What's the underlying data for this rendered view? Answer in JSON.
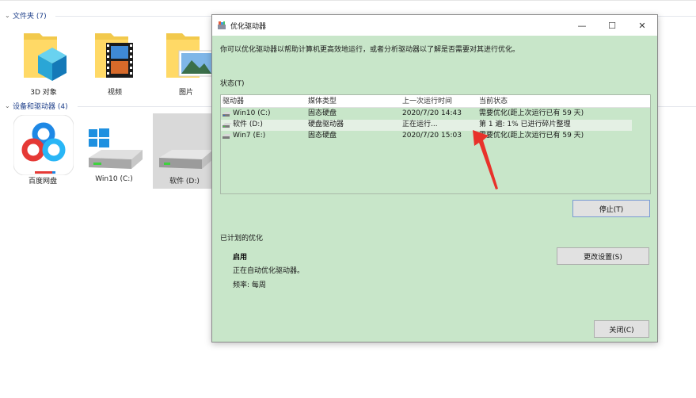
{
  "explorer": {
    "folders_group": {
      "label": "文件夹 (7)"
    },
    "folders": [
      {
        "label": "3D 对象",
        "icon": "3d-objects-folder-icon"
      },
      {
        "label": "视频",
        "icon": "videos-folder-icon"
      },
      {
        "label": "图片",
        "icon": "pictures-folder-icon"
      }
    ],
    "drives_group": {
      "label": "设备和驱动器 (4)"
    },
    "drives": [
      {
        "label": "百度网盘",
        "icon": "baidu-netdisk-icon"
      },
      {
        "label": "Win10 (C:)",
        "icon": "hard-drive-icon"
      },
      {
        "label": "软件 (D:)",
        "icon": "hard-drive-icon",
        "selected": true
      }
    ]
  },
  "dialog": {
    "title": "优化驱动器",
    "intro": "你可以优化驱动器以帮助计算机更高效地运行，或者分析驱动器以了解是否需要对其进行优化。",
    "status_label": "状态(T)",
    "columns": [
      "驱动器",
      "媒体类型",
      "上一次运行时间",
      "当前状态"
    ],
    "rows": [
      {
        "drive": "Win10 (C:)",
        "media": "固态硬盘",
        "last_run": "2020/7/20 14:43",
        "status": "需要优化(距上次运行已有 59 天)"
      },
      {
        "drive": "软件 (D:)",
        "media": "硬盘驱动器",
        "last_run": "正在运行...",
        "status": "第 1 遍: 1% 已进行碎片整理"
      },
      {
        "drive": "Win7 (E:)",
        "media": "固态硬盘",
        "last_run": "2020/7/20 15:03",
        "status": "需要优化(距上次运行已有 59 天)"
      }
    ],
    "stop_button": "停止(T)",
    "scheduled_label": "已计划的优化",
    "enabled_label": "启用",
    "auto_text": "正在自动优化驱动器。",
    "frequency_text": "频率: 每周",
    "change_settings_button": "更改设置(S)",
    "close_button": "关闭(C)",
    "window_buttons": {
      "minimize": "—",
      "maximize": "☐",
      "close": "✕"
    }
  },
  "colors": {
    "dialog_background": "#c8e6c9",
    "group_header": "#1e3f8a",
    "annotation_arrow": "#e8322a"
  }
}
